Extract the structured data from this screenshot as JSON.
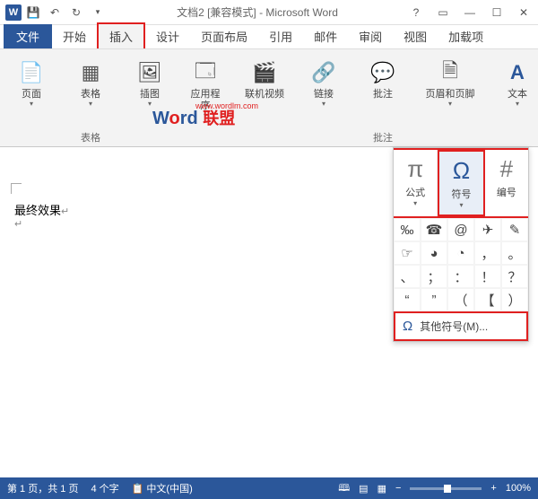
{
  "title": "文档2 [兼容模式] - Microsoft Word",
  "tabs": {
    "file": "文件",
    "home": "开始",
    "insert": "插入",
    "design": "设计",
    "layout": "页面布局",
    "references": "引用",
    "mailings": "邮件",
    "review": "审阅",
    "view": "视图",
    "addins": "加载项"
  },
  "ribbon": {
    "page": "页面",
    "table": "表格",
    "tableGroup": "表格",
    "illustration": "插图",
    "apps": "应用程\n序",
    "video": "联机视频",
    "links": "链接",
    "comments": "批注",
    "commentsGroup": "批注",
    "headerfooter": "页眉和页脚",
    "text": "文本",
    "symbol": "符号"
  },
  "watermark": {
    "url": "www.wordlm.com"
  },
  "symbolPanel": {
    "equation": "公式",
    "symbol": "符号",
    "number": "编号",
    "grid": [
      "‰",
      "☎",
      "@",
      "✈",
      "✎",
      "☞",
      "◕",
      "◔",
      "，",
      "。",
      "、",
      "；",
      "：",
      "！",
      "？",
      "“",
      "”",
      "（",
      "【",
      "）"
    ],
    "more": "其他符号(M)..."
  },
  "document": {
    "text": "最终效果",
    "mark1": "↵",
    "mark2": "↵"
  },
  "status": {
    "page": "第 1 页，共 1 页",
    "words": "4 个字",
    "lang": "中文(中国)",
    "zoom": "100%"
  }
}
